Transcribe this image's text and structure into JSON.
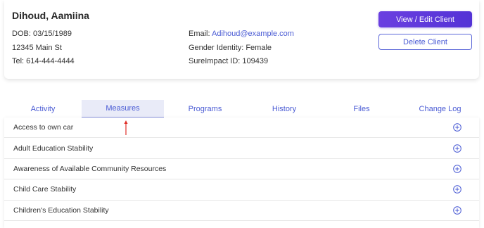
{
  "client": {
    "name": "Dihoud, Aamiina",
    "dob": "DOB: 03/15/1989",
    "address": "12345 Main St",
    "tel": "Tel: 614-444-4444",
    "email_label": "Email:",
    "email": "Adihoud@example.com",
    "gender": "Gender Identity: Female",
    "sureimpact_id": "SureImpact ID: 109439"
  },
  "buttons": {
    "view_edit": "View / Edit Client",
    "delete": "Delete Client"
  },
  "tabs": [
    {
      "label": "Activity"
    },
    {
      "label": "Measures"
    },
    {
      "label": "Programs"
    },
    {
      "label": "History"
    },
    {
      "label": "Files"
    },
    {
      "label": "Change Log"
    }
  ],
  "active_tab": "Measures",
  "measures": [
    {
      "label": "Access to own car"
    },
    {
      "label": "Adult Education Stability"
    },
    {
      "label": "Awareness of Available Community Resources"
    },
    {
      "label": "Child Care Stability"
    },
    {
      "label": "Children's Education Stability"
    }
  ],
  "colors": {
    "accent": "#4a5bd4",
    "primary_button": "#5b36db",
    "annotation_arrow": "#e0302a"
  }
}
